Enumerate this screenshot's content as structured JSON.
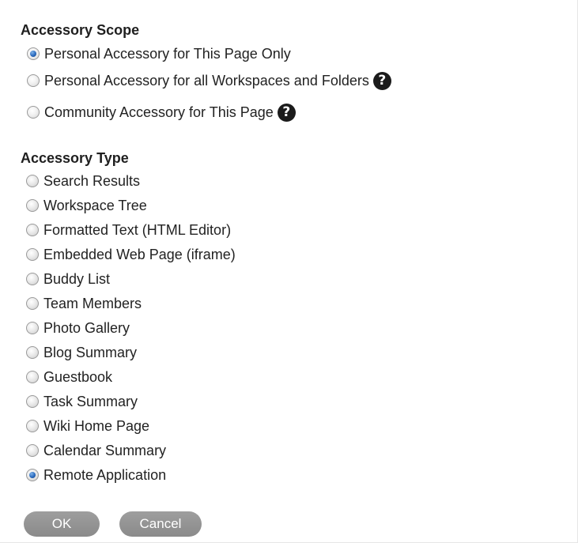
{
  "scope": {
    "title": "Accessory Scope",
    "options": [
      {
        "label": "Personal Accessory for This Page Only",
        "selected": true,
        "help": false
      },
      {
        "label": "Personal Accessory for all Workspaces and Folders",
        "selected": false,
        "help": true
      },
      {
        "label": "Community Accessory for This Page",
        "selected": false,
        "help": true
      }
    ],
    "help_glyph": "?"
  },
  "type": {
    "title": "Accessory Type",
    "options": [
      {
        "label": "Search Results",
        "selected": false
      },
      {
        "label": "Workspace Tree",
        "selected": false
      },
      {
        "label": "Formatted Text (HTML Editor)",
        "selected": false
      },
      {
        "label": "Embedded Web Page (iframe)",
        "selected": false
      },
      {
        "label": "Buddy List",
        "selected": false
      },
      {
        "label": "Team Members",
        "selected": false
      },
      {
        "label": "Photo Gallery",
        "selected": false
      },
      {
        "label": "Blog Summary",
        "selected": false
      },
      {
        "label": "Guestbook",
        "selected": false
      },
      {
        "label": "Task Summary",
        "selected": false
      },
      {
        "label": "Wiki Home Page",
        "selected": false
      },
      {
        "label": "Calendar Summary",
        "selected": false
      },
      {
        "label": "Remote Application",
        "selected": true
      }
    ]
  },
  "buttons": {
    "ok_label": "OK",
    "cancel_label": "Cancel"
  },
  "colors": {
    "button_bg": "#939393",
    "radio_selected": "#2a6bbf",
    "help_icon_bg": "#1b1b1b"
  }
}
